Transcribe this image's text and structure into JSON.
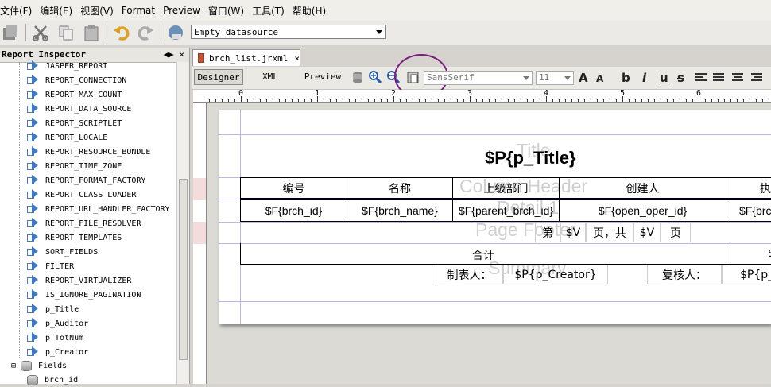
{
  "menu": [
    "文件(F)",
    "编辑(E)",
    "视图(V)",
    "Format",
    "Preview",
    "窗口(W)",
    "工具(T)",
    "帮助(H)"
  ],
  "toolbar": {
    "datasource": "Empty datasource"
  },
  "inspector": {
    "title": "Report Inspector",
    "controls": "◀▶ ×",
    "items": [
      "JASPER_REPORT",
      "REPORT_CONNECTION",
      "REPORT_MAX_COUNT",
      "REPORT_DATA_SOURCE",
      "REPORT_SCRIPTLET",
      "REPORT_LOCALE",
      "REPORT_RESOURCE_BUNDLE",
      "REPORT_TIME_ZONE",
      "REPORT_FORMAT_FACTORY",
      "REPORT_CLASS_LOADER",
      "REPORT_URL_HANDLER_FACTORY",
      "REPORT_FILE_RESOLVER",
      "REPORT_TEMPLATES",
      "SORT_FIELDS",
      "FILTER",
      "REPORT_VIRTUALIZER",
      "IS_IGNORE_PAGINATION",
      "p_Title",
      "p_Auditor",
      "p_TotNum",
      "p_Creator"
    ],
    "fields_label": "Fields",
    "field_item": "brch_id"
  },
  "editor": {
    "tab": "brch_list.jrxml",
    "tab_close": "×",
    "modes": [
      "Designer",
      "XML",
      "Preview"
    ],
    "font": "SansSerif",
    "size": "11",
    "ruler_nums": [
      "0",
      "1",
      "2",
      "3",
      "4",
      "5",
      "6"
    ]
  },
  "report": {
    "title": "$P{p_Title}",
    "bands": [
      "Title",
      "Column Header",
      "Detail 1",
      "Page Footer",
      "Summary"
    ],
    "headers": [
      "编号",
      "名称",
      "上级部门",
      "创建人",
      "执"
    ],
    "fields": [
      "$F{brch_id}",
      "$F{brch_name}",
      "$F{parent_brch_id}",
      "$F{open_oper_id}",
      "$F{brc"
    ],
    "footer": [
      "第",
      "$V",
      "页，共",
      "$V",
      "页"
    ],
    "total_label": "合计",
    "total_right": "$",
    "creator_label": "制表人：",
    "creator_value": "$P{p_Creator}",
    "auditor_label": "复核人：",
    "auditor_value": "$P{p_"
  }
}
